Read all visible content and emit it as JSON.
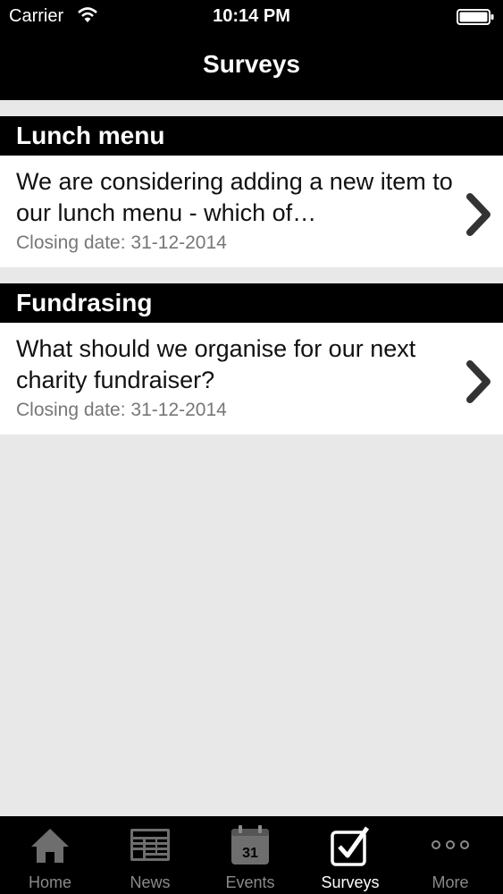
{
  "status_bar": {
    "carrier": "Carrier",
    "time": "10:14 PM",
    "wifi_icon": "wifi-icon",
    "battery_icon": "battery-icon"
  },
  "nav": {
    "title": "Surveys"
  },
  "sections": [
    {
      "header": "Lunch menu",
      "survey": {
        "question": "We are considering adding a new item to our lunch menu - which of…",
        "closing": "Closing date: 31-12-2014"
      }
    },
    {
      "header": "Fundrasing",
      "survey": {
        "question": "What should we organise for our next charity fundraiser?",
        "closing": "Closing date: 31-12-2014"
      }
    }
  ],
  "tab_bar": {
    "active_tab": "Surveys",
    "tabs": [
      {
        "label": "Home",
        "icon": "home-icon"
      },
      {
        "label": "News",
        "icon": "news-icon"
      },
      {
        "label": "Events",
        "icon": "calendar-icon",
        "icon_text": "31"
      },
      {
        "label": "Surveys",
        "icon": "checkbox-icon"
      },
      {
        "label": "More",
        "icon": "more-icon"
      }
    ]
  },
  "colors": {
    "bar_background": "#000000",
    "page_background": "#e8e8e8",
    "inactive_tab": "#8a8a8a",
    "active_tab": "#ffffff",
    "closing_text": "#777777"
  }
}
